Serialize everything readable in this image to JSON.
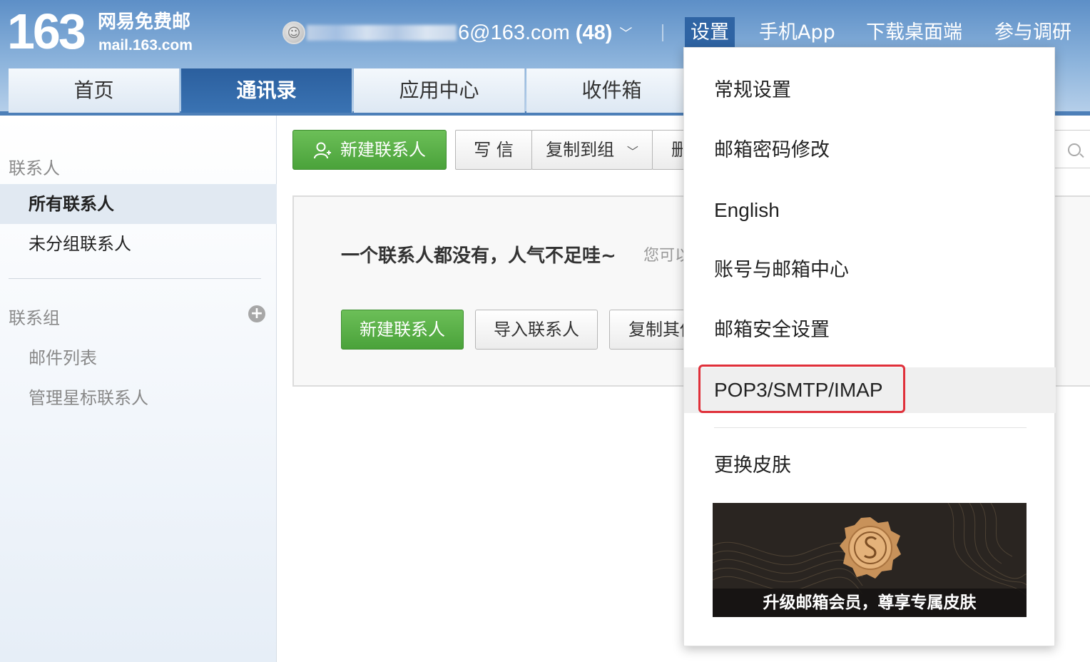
{
  "brand": {
    "logo_number": "163",
    "logo_name": "网易免费邮",
    "logo_url": "mail.163.com"
  },
  "account": {
    "email_suffix": "6@163.com",
    "unread_count": "(48)"
  },
  "top_links": [
    "设置",
    "手机App",
    "下载桌面端",
    "参与调研"
  ],
  "nav_tabs": [
    "首页",
    "通讯录",
    "应用中心",
    "收件箱"
  ],
  "sidebar": {
    "contacts_section": "联系人",
    "contacts_items": [
      "所有联系人",
      "未分组联系人"
    ],
    "groups_section": "联系组",
    "groups_items": [
      "邮件列表",
      "管理星标联系人"
    ]
  },
  "toolbar": {
    "new_contact": "新建联系人",
    "write": "写 信",
    "copy_to_group": "复制到组",
    "delete_partial": "删"
  },
  "empty_state": {
    "message": "一个联系人都没有，人气不足哇~",
    "hint": "您可以",
    "buttons": [
      "新建联系人",
      "导入联系人",
      "复制其他"
    ]
  },
  "settings_menu": {
    "items": [
      "常规设置",
      "邮箱密码修改",
      "English",
      "账号与邮箱中心",
      "邮箱安全设置",
      "POP3/SMTP/IMAP",
      "更换皮肤"
    ],
    "banner_text": "升级邮箱会员，尊享专属皮肤"
  },
  "colors": {
    "header_blue": "#5d8fc7",
    "active_tab": "#2b5f9e",
    "green_button": "#4aa23a",
    "highlight_red": "#e0303a"
  }
}
